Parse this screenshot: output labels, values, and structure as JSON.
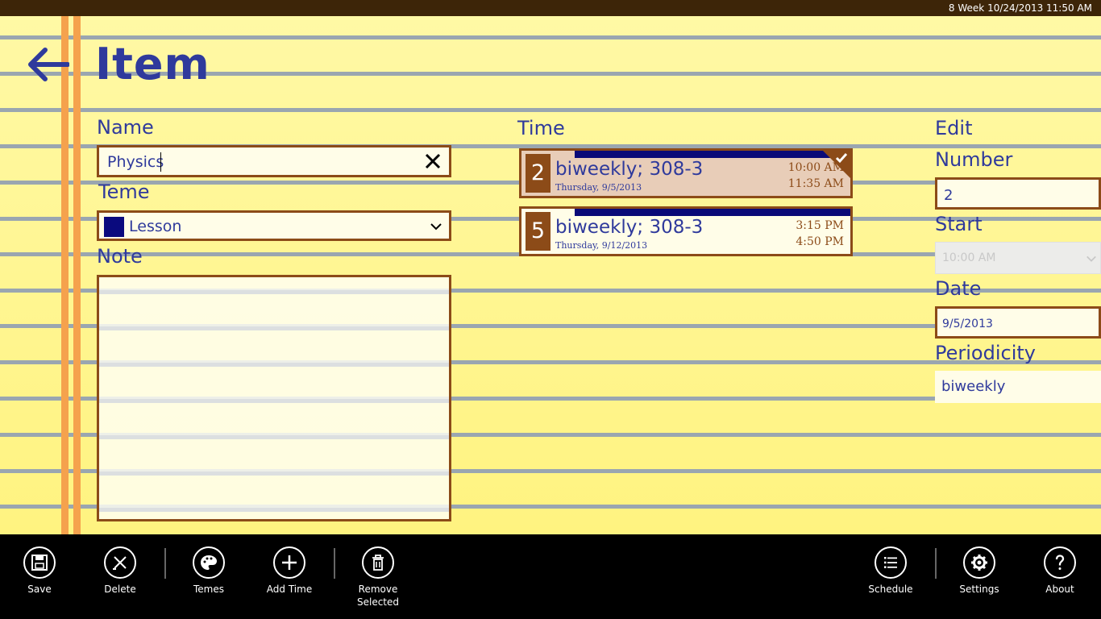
{
  "status_bar": {
    "text": "8 Week 10/24/2013 11:50 AM"
  },
  "header": {
    "title": "Item"
  },
  "form": {
    "name_label": "Name",
    "name_value": "Physics",
    "theme_label": "Teme",
    "theme_value": "Lesson",
    "theme_color": "#0a0a7e",
    "note_label": "Note",
    "note_value": ""
  },
  "times": {
    "label": "Time",
    "items": [
      {
        "number": "2",
        "title": "biweekly; 308-3",
        "date": "Thursday, 9/5/2013",
        "start": "10:00 AM",
        "end": "11:35 AM",
        "selected": true
      },
      {
        "number": "5",
        "title": "biweekly; 308-3",
        "date": "Thursday, 9/12/2013",
        "start": "3:15 PM",
        "end": "4:50 PM",
        "selected": false
      }
    ]
  },
  "edit": {
    "label": "Edit",
    "number_label": "Number",
    "number_value": "2",
    "start_label": "Start",
    "start_value": "10:00 AM",
    "date_label": "Date",
    "date_value": "9/5/2013",
    "periodicity_label": "Periodicity",
    "periodicity_value": "biweekly"
  },
  "app_bar": {
    "left": [
      {
        "label": "Save",
        "icon": "save-icon"
      },
      {
        "label": "Delete",
        "icon": "delete-icon"
      },
      {
        "label": "Temes",
        "icon": "palette-icon"
      },
      {
        "label": "Add Time",
        "icon": "add-icon"
      },
      {
        "label": "Remove Selected",
        "icon": "trash-icon"
      }
    ],
    "right": [
      {
        "label": "Schedule",
        "icon": "list-icon"
      },
      {
        "label": "Settings",
        "icon": "gear-icon"
      },
      {
        "label": "About",
        "icon": "help-icon"
      }
    ]
  },
  "colors": {
    "accent_blue": "#2f3a9c",
    "border_brown": "#8c4b18",
    "paper_yellow": "#fff59a",
    "margin_orange": "#f5a24d"
  }
}
